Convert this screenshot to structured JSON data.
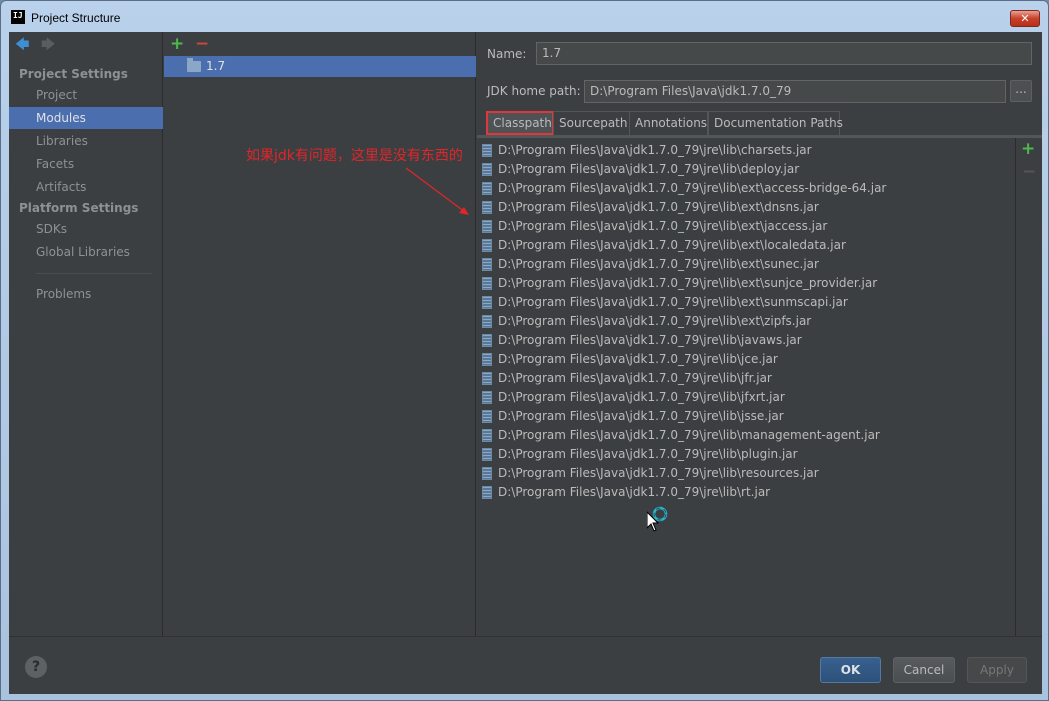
{
  "window": {
    "title": "Project Structure",
    "logo_text": "IJ",
    "close_label": "✕"
  },
  "sidebar": {
    "project_settings_title": "Project Settings",
    "platform_settings_title": "Platform Settings",
    "items": [
      {
        "label": "Project"
      },
      {
        "label": "Modules",
        "selected": true
      },
      {
        "label": "Libraries"
      },
      {
        "label": "Facets"
      },
      {
        "label": "Artifacts"
      },
      {
        "label": "SDKs"
      },
      {
        "label": "Global Libraries"
      },
      {
        "label": "Problems"
      }
    ]
  },
  "tree": {
    "add_icon": "+",
    "remove_icon": "−",
    "selected_item": "1.7"
  },
  "detail": {
    "name_label": "Name:",
    "name_value": "1.7",
    "jdk_label": "JDK home path:",
    "jdk_value": "D:\\Program Files\\Java\\jdk1.7.0_79",
    "browse_label": "...",
    "tabs": [
      {
        "label": "Classpath",
        "active": true
      },
      {
        "label": "Sourcepath"
      },
      {
        "label": "Annotations"
      },
      {
        "label": "Documentation Paths"
      }
    ],
    "classpath": [
      "D:\\Program Files\\Java\\jdk1.7.0_79\\jre\\lib\\charsets.jar",
      "D:\\Program Files\\Java\\jdk1.7.0_79\\jre\\lib\\deploy.jar",
      "D:\\Program Files\\Java\\jdk1.7.0_79\\jre\\lib\\ext\\access-bridge-64.jar",
      "D:\\Program Files\\Java\\jdk1.7.0_79\\jre\\lib\\ext\\dnsns.jar",
      "D:\\Program Files\\Java\\jdk1.7.0_79\\jre\\lib\\ext\\jaccess.jar",
      "D:\\Program Files\\Java\\jdk1.7.0_79\\jre\\lib\\ext\\localedata.jar",
      "D:\\Program Files\\Java\\jdk1.7.0_79\\jre\\lib\\ext\\sunec.jar",
      "D:\\Program Files\\Java\\jdk1.7.0_79\\jre\\lib\\ext\\sunjce_provider.jar",
      "D:\\Program Files\\Java\\jdk1.7.0_79\\jre\\lib\\ext\\sunmscapi.jar",
      "D:\\Program Files\\Java\\jdk1.7.0_79\\jre\\lib\\ext\\zipfs.jar",
      "D:\\Program Files\\Java\\jdk1.7.0_79\\jre\\lib\\javaws.jar",
      "D:\\Program Files\\Java\\jdk1.7.0_79\\jre\\lib\\jce.jar",
      "D:\\Program Files\\Java\\jdk1.7.0_79\\jre\\lib\\jfr.jar",
      "D:\\Program Files\\Java\\jdk1.7.0_79\\jre\\lib\\jfxrt.jar",
      "D:\\Program Files\\Java\\jdk1.7.0_79\\jre\\lib\\jsse.jar",
      "D:\\Program Files\\Java\\jdk1.7.0_79\\jre\\lib\\management-agent.jar",
      "D:\\Program Files\\Java\\jdk1.7.0_79\\jre\\lib\\plugin.jar",
      "D:\\Program Files\\Java\\jdk1.7.0_79\\jre\\lib\\resources.jar",
      "D:\\Program Files\\Java\\jdk1.7.0_79\\jre\\lib\\rt.jar"
    ],
    "side_add_icon": "+",
    "side_remove_icon": "−"
  },
  "annotation": {
    "text": "如果jdk有问题，这里是没有东西的",
    "color": "#e0262a"
  },
  "footer": {
    "help_label": "?",
    "ok_label": "OK",
    "cancel_label": "Cancel",
    "apply_label": "Apply"
  },
  "colors": {
    "background": "#3c3f41",
    "selection": "#4b6eaf",
    "text": "#bbbbbb",
    "add_green": "#4fb84a",
    "remove_red": "#c9473c"
  }
}
